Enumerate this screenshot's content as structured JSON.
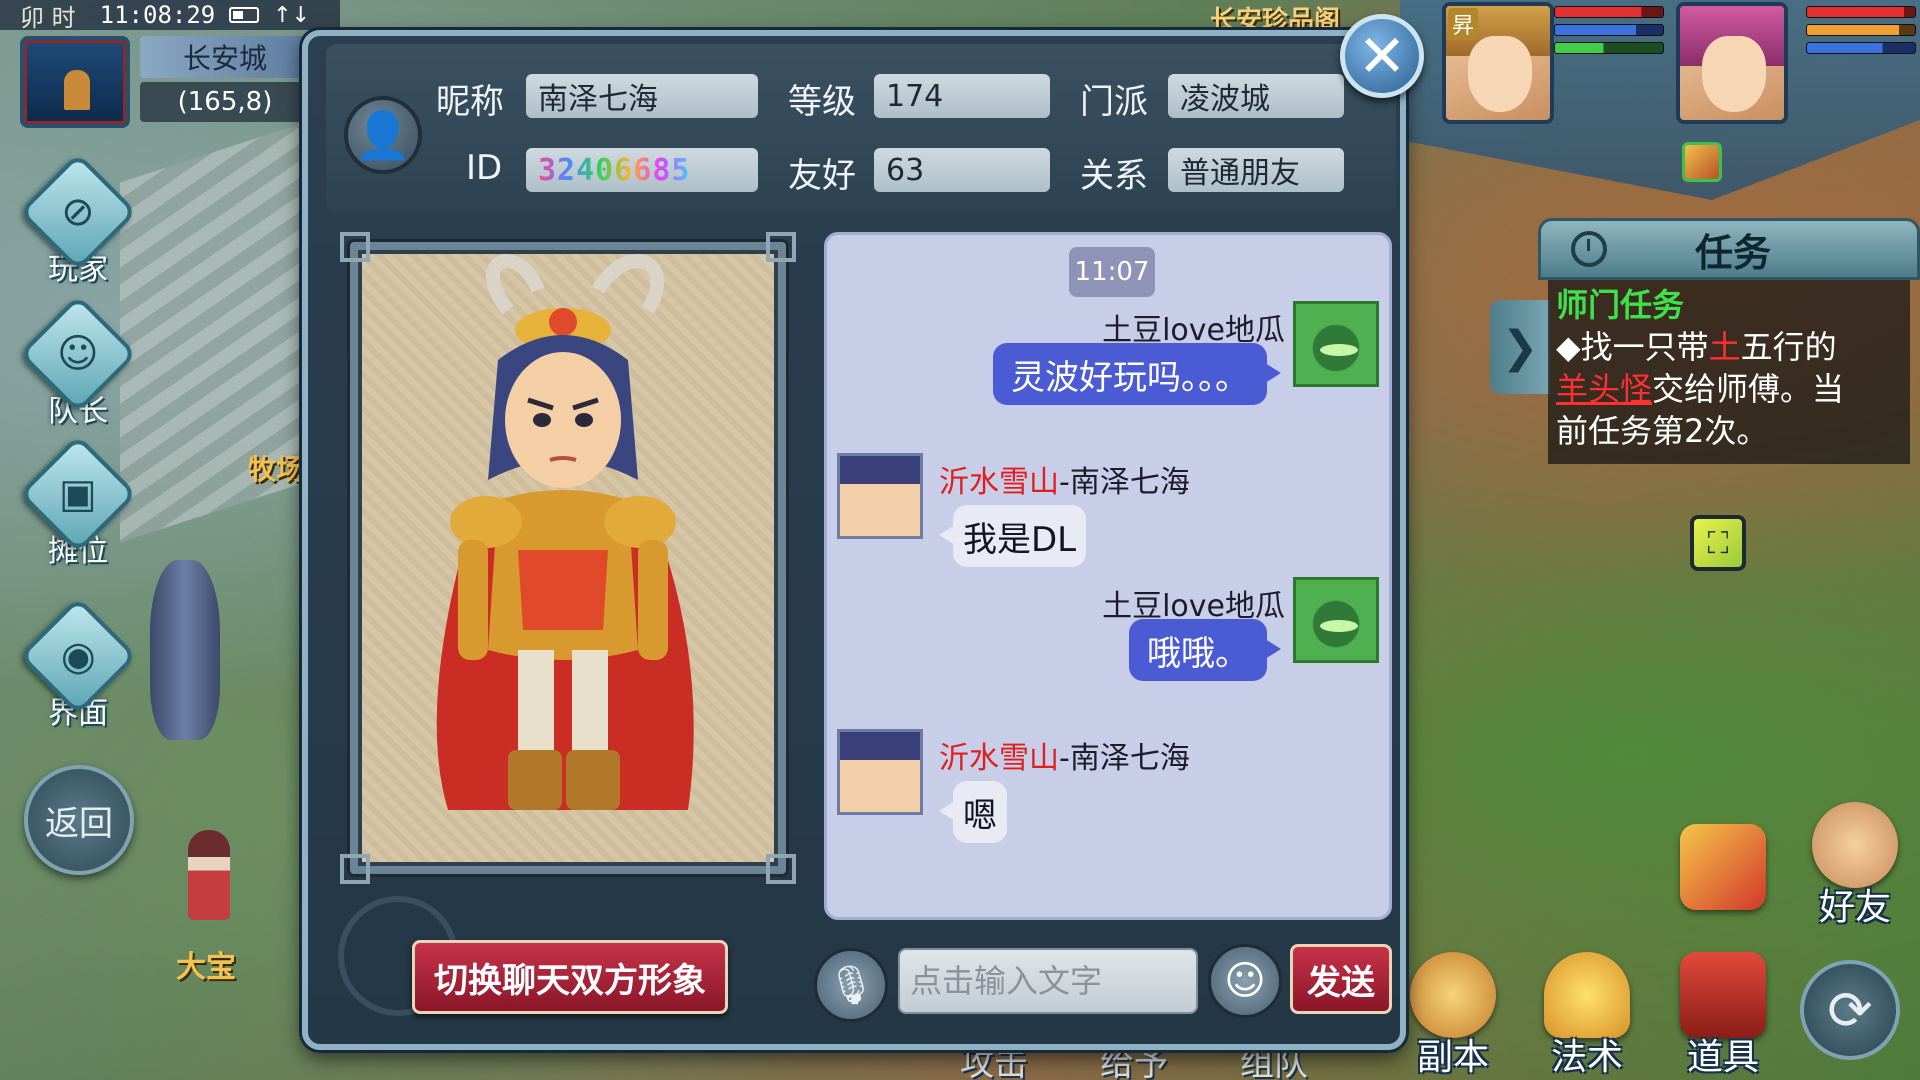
{
  "status": {
    "shichen": "卯 时",
    "time": "11:08:29",
    "signal_icon": "↑↓"
  },
  "map": {
    "name": "长安城",
    "coords": "(165,8)",
    "banner_label": "长安珍品阁"
  },
  "world_labels": {
    "pasture": "牧场",
    "npc_name": "大宝"
  },
  "side_menu": {
    "items": [
      {
        "label": "玩家",
        "icon": "⊘"
      },
      {
        "label": "队长",
        "icon": "☺"
      },
      {
        "label": "摊位",
        "icon": "▣"
      },
      {
        "label": "界面",
        "icon": "◉"
      }
    ],
    "back_label": "返回"
  },
  "portraits": {
    "first_tag": "昇"
  },
  "quest": {
    "header": "任务",
    "title": "师门任务",
    "line1_pre": "◆找一只带",
    "line1_red": "土",
    "line1_post": "五行的",
    "line2_link": "羊头怪",
    "line2_post": "交给师傅。当",
    "line3": "前任务第2次。"
  },
  "profile": {
    "nickname_label": "昵称",
    "nickname": "南泽七海",
    "level_label": "等级",
    "level": "174",
    "school_label": "门派",
    "school": "凌波城",
    "id_label": "ID",
    "id": "32406685",
    "friendship_label": "友好",
    "friendship": "63",
    "relation_label": "关系",
    "relation": "普通朋友"
  },
  "chat": {
    "time": "11:07",
    "messages": [
      {
        "side": "right",
        "sender": "土豆love地瓜",
        "text": "灵波好玩吗。。。"
      },
      {
        "side": "left",
        "sender_guild": "沂水雪山",
        "sender_name": "-南泽七海",
        "text": "我是DL"
      },
      {
        "side": "right",
        "sender": "土豆love地瓜",
        "text": "哦哦。"
      },
      {
        "side": "left",
        "sender_guild": "沂水雪山",
        "sender_name": "-南泽七海",
        "text": "嗯"
      }
    ],
    "input_placeholder": "点击输入文字",
    "send_label": "发送",
    "switch_label": "切换聊天双方形象"
  },
  "bottom_bar": {
    "attack": "攻击",
    "give": "给予",
    "team": "组队",
    "dungeon": "副本",
    "spell": "法术",
    "items": "道具",
    "friends": "好友"
  },
  "colors": {
    "accent_red": "#c7334a",
    "bubble_blue": "#4a5bd3",
    "chat_bg": "#c8cde8",
    "quest_green": "#3fe14a",
    "guild_red": "#e01e1e"
  }
}
